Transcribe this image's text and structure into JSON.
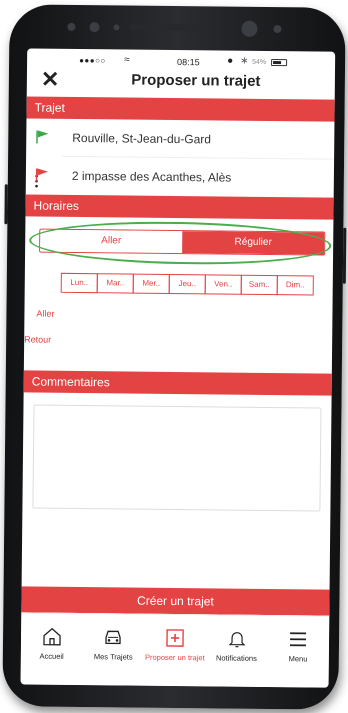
{
  "status": {
    "carrier": "●●●○○",
    "time": "08:15",
    "battery_pct": "54%"
  },
  "nav": {
    "title": "Proposer un trajet"
  },
  "trajet": {
    "header": "Trajet",
    "from": "Rouville, St-Jean-du-Gard",
    "to": "2 impasse des Acanthes, Alès"
  },
  "horaires": {
    "header": "Horaires",
    "mode_options": [
      "Aller",
      "Régulier"
    ],
    "selected_mode": "Régulier",
    "days": [
      "Lun..",
      "Mar..",
      "Mer..",
      "Jeu..",
      "Ven..",
      "Sam..",
      "Dim.."
    ],
    "row_aller": "Aller",
    "row_retour": "Retour"
  },
  "commentaires": {
    "header": "Commentaires",
    "value": ""
  },
  "actions": {
    "create_label": "Créer un trajet"
  },
  "tabs": [
    {
      "label": "Accueil",
      "icon": "home-icon"
    },
    {
      "label": "Mes Trajets",
      "icon": "car-icon"
    },
    {
      "label": "Proposer un trajet",
      "icon": "plus-icon"
    },
    {
      "label": "Notifications",
      "icon": "bell-icon"
    },
    {
      "label": "Menu",
      "icon": "menu-icon"
    }
  ],
  "colors": {
    "accent": "#e44344",
    "highlight_ellipse": "#4cad4c",
    "flag_start": "#3aa84a",
    "flag_end": "#e44344"
  }
}
